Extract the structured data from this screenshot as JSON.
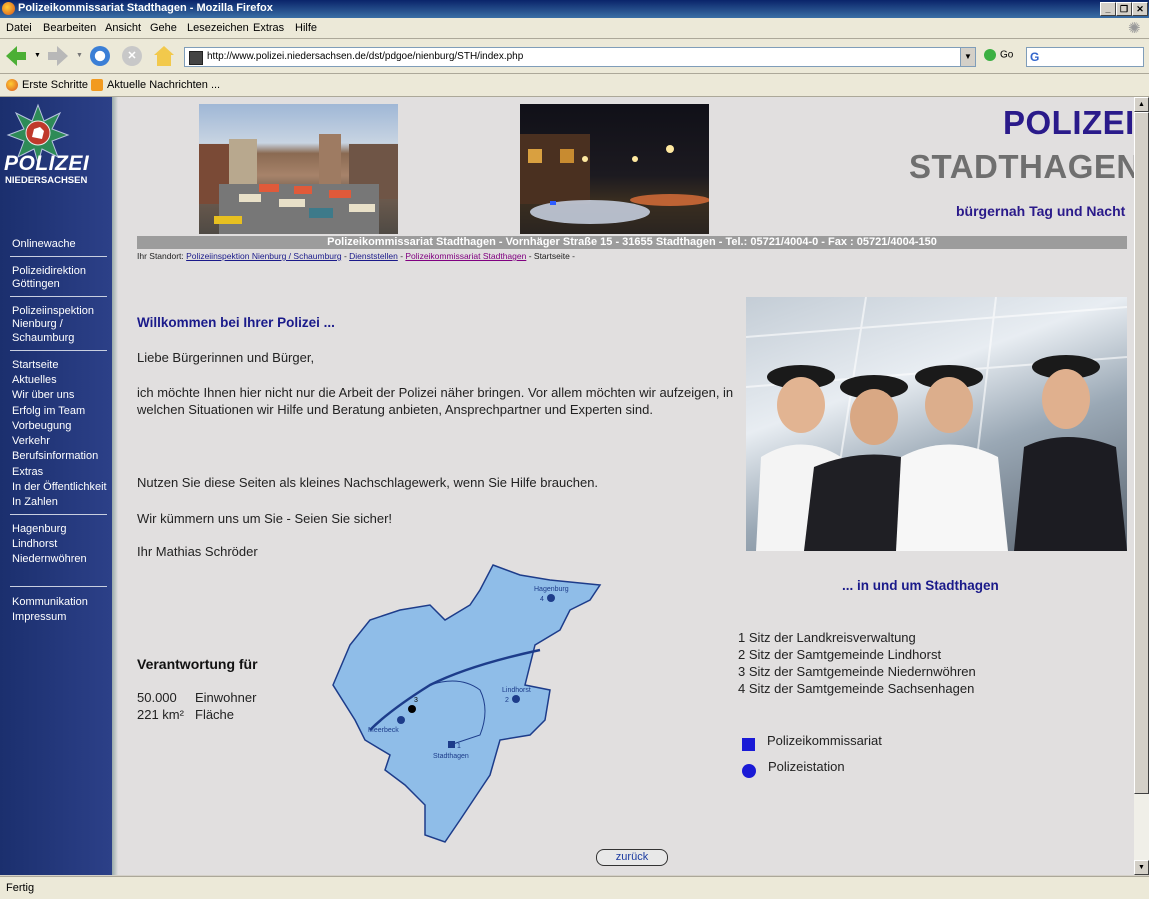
{
  "window": {
    "title": "Polizeikommissariat Stadthagen - Mozilla Firefox"
  },
  "menu": [
    "Datei",
    "Bearbeiten",
    "Ansicht",
    "Gehe",
    "Lesezeichen",
    "Extras",
    "Hilfe"
  ],
  "toolbar": {
    "url": "http://www.polizei.niedersachsen.de/dst/pdgoe/nienburg/STH/index.php",
    "go_label": "Go"
  },
  "bookmarks": [
    "Erste Schritte",
    "Aktuelle Nachrichten ..."
  ],
  "logo": {
    "title": "POLIZEI",
    "subtitle": "NIEDERSACHSEN"
  },
  "sidebar": {
    "group1": [
      "Onlinewache"
    ],
    "group2": [
      "Polizeidirektion",
      "Göttingen"
    ],
    "group3": [
      "Polizeiinspektion",
      "Nienburg /",
      "Schaumburg"
    ],
    "group4": [
      "Startseite",
      "Aktuelles",
      "Wir über uns",
      "Erfolg im Team",
      "Vorbeugung",
      "Verkehr",
      "Berufsinformation",
      "Extras",
      "In der Öffentlichkeit",
      "In Zahlen"
    ],
    "group5": [
      "Hagenburg",
      "Lindhorst",
      "Niedernwöhren"
    ],
    "group6": [
      "Kommunikation",
      "Impressum"
    ]
  },
  "header": {
    "title1": "POLIZEI",
    "title2": "STADTHAGEN",
    "slogan": "bürgernah Tag und Nacht",
    "address": "Polizeikommissariat Stadthagen - Vornhäger Straße 15 - 31655 Stadthagen - Tel.: 05721/4004-0 - Fax : 05721/4004-150"
  },
  "breadcrumb": {
    "prefix": "Ihr Standort: ",
    "link1": "Polizeiinspektion Nienburg / Schaumburg",
    "sep": " - ",
    "link2": "Dienststellen",
    "link3": "Polizeikommissariat Stadthagen",
    "current": " - Startseite -"
  },
  "main": {
    "heading": "Willkommen bei Ihrer Polizei ...",
    "greeting": "Liebe Bürgerinnen und Bürger,",
    "para1": "ich möchte Ihnen hier nicht nur die Arbeit der Polizei näher bringen. Vor allem möchten wir aufzeigen, in welchen Situationen wir Hilfe und Beratung anbieten, Ansprechpartner und Experten sind.",
    "para2": "Nutzen Sie diese Seiten als kleines Nachschlagewerk, wenn Sie Hilfe brauchen.",
    "para3": "Wir kümmern uns um Sie - Seien Sie sicher!",
    "signature": "Ihr Mathias Schröder"
  },
  "stats": {
    "heading": "Verantwortung für",
    "rows": [
      {
        "value": "50.000",
        "label": "Einwohner"
      },
      {
        "value": "221 km²",
        "label": "Fläche"
      }
    ]
  },
  "map": {
    "places": [
      {
        "num": "4",
        "name": "Hagenburg"
      },
      {
        "num": "2",
        "name": "Lindhorst"
      },
      {
        "num": "3",
        "name": ""
      },
      {
        "num": "",
        "name": "Meerbeck"
      },
      {
        "num": "1",
        "name": "Stadthagen"
      }
    ]
  },
  "region": {
    "heading": "... in und um Stadthagen",
    "items": [
      "1 Sitz der Landkreisverwaltung",
      "2 Sitz der Samtgemeinde Lindhorst",
      "3 Sitz der Samtgemeinde Niedernwöhren",
      "4 Sitz der Samtgemeinde Sachsenhagen"
    ],
    "legend": [
      {
        "label": "Polizeikommissariat",
        "shape": "square"
      },
      {
        "label": "Polizeistation",
        "shape": "circle"
      }
    ]
  },
  "footer": {
    "back_label": "zurück"
  },
  "status": {
    "text": "Fertig"
  },
  "colors": {
    "sidebar": "#1b2f6e",
    "heading": "#1a1a8a",
    "content_bg": "#e1dfdf",
    "map_fill": "#8fbde8"
  }
}
